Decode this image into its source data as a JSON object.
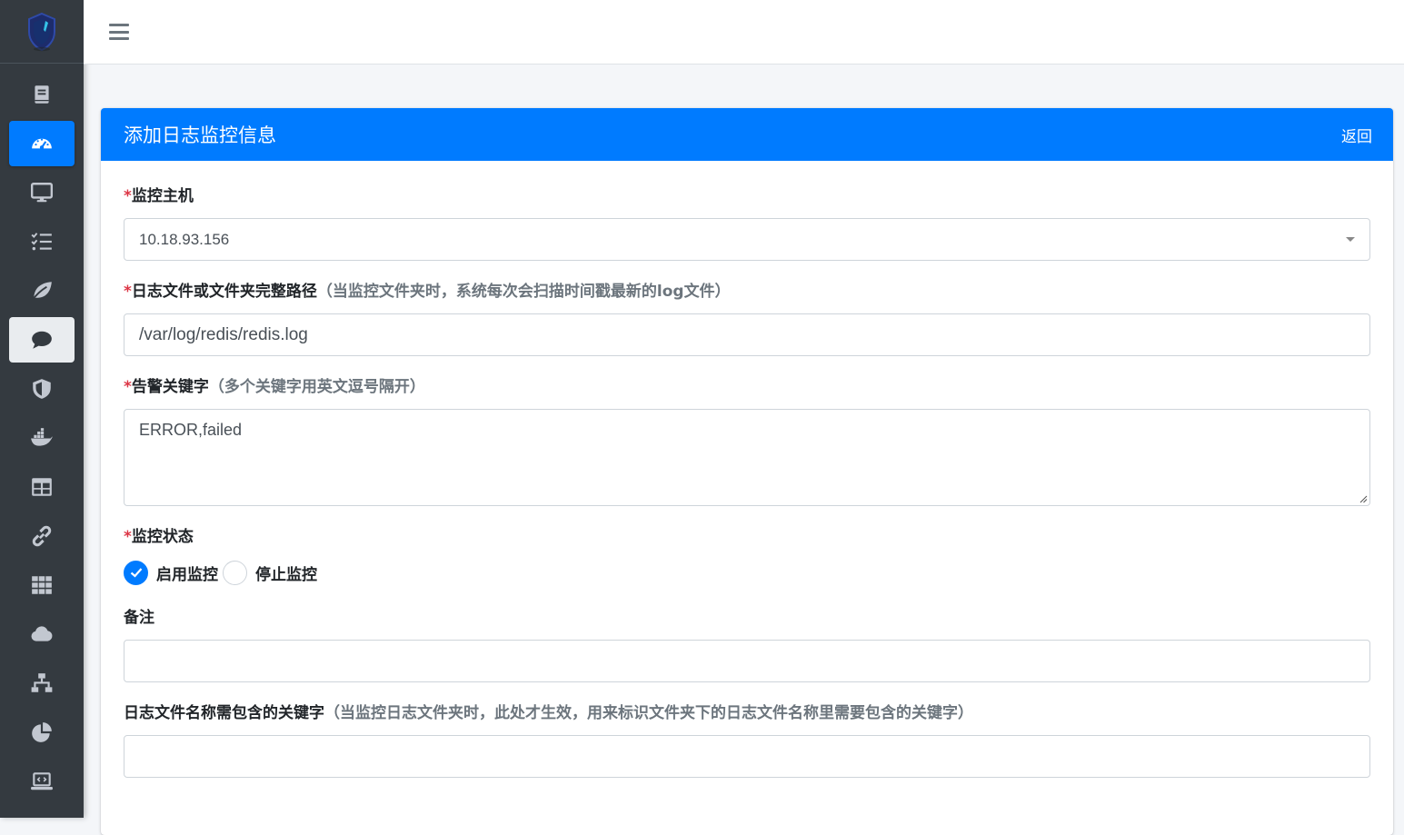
{
  "sidebar": {
    "logo_icon": "shield-logo-icon",
    "items": [
      {
        "icon": "book-icon",
        "state": "normal"
      },
      {
        "icon": "dashboard-gauge-icon",
        "state": "active-blue"
      },
      {
        "icon": "desktop-icon",
        "state": "normal"
      },
      {
        "icon": "task-list-icon",
        "state": "normal"
      },
      {
        "icon": "leaf-icon",
        "state": "normal"
      },
      {
        "icon": "comment-icon",
        "state": "active-light"
      },
      {
        "icon": "shield-icon",
        "state": "normal"
      },
      {
        "icon": "docker-icon",
        "state": "normal"
      },
      {
        "icon": "table-icon",
        "state": "normal"
      },
      {
        "icon": "link-icon",
        "state": "normal"
      },
      {
        "icon": "grid-icon",
        "state": "normal"
      },
      {
        "icon": "cloud-icon",
        "state": "normal"
      },
      {
        "icon": "sitemap-icon",
        "state": "normal"
      },
      {
        "icon": "pie-chart-icon",
        "state": "normal"
      },
      {
        "icon": "laptop-code-icon",
        "state": "normal"
      }
    ],
    "active_color": "#007bff",
    "bg_color": "#343a40"
  },
  "header": {
    "title": "添加日志监控信息",
    "back_label": "返回",
    "color": "#007bff"
  },
  "form": {
    "host": {
      "required_mark": "*",
      "label": "监控主机",
      "value": "10.18.93.156"
    },
    "path": {
      "required_mark": "*",
      "label": "日志文件或文件夹完整路径",
      "hint": "（当监控文件夹时，系统每次会扫描时间戳最新的log文件）",
      "value": "/var/log/redis/redis.log"
    },
    "keywords": {
      "required_mark": "*",
      "label": "告警关键字",
      "hint": "（多个关键字用英文逗号隔开）",
      "value": "ERROR,failed"
    },
    "status": {
      "required_mark": "*",
      "label": "监控状态",
      "options": [
        {
          "label": "启用监控",
          "checked": true
        },
        {
          "label": "停止监控",
          "checked": false
        }
      ]
    },
    "remark": {
      "label": "备注",
      "value": ""
    },
    "filename_keyword": {
      "label": "日志文件名称需包含的关键字",
      "hint": "（当监控日志文件夹时，此处才生效，用来标识文件夹下的日志文件名称里需要包含的关键字）",
      "value": ""
    }
  }
}
